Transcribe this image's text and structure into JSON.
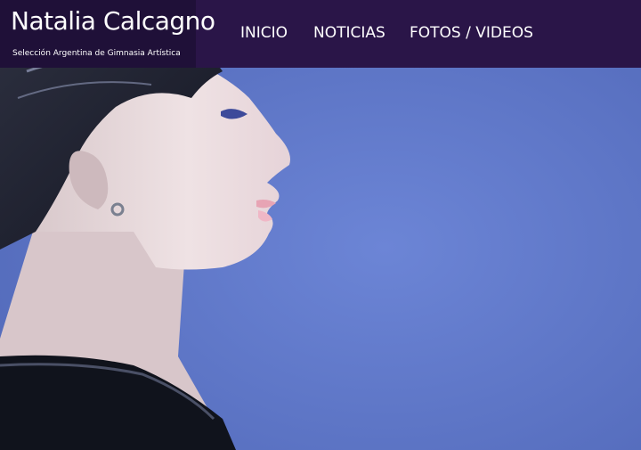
{
  "brand": {
    "title": "Natalia Calcagno",
    "subtitle": "Selección Argentina de Gimnasia Artística"
  },
  "nav": {
    "items": [
      {
        "label": "INICIO"
      },
      {
        "label": "NOTICIAS"
      },
      {
        "label": "FOTOS / VIDEOS"
      }
    ]
  },
  "colors": {
    "header_bg": "#2a1548",
    "brand_bg": "#1c0f33",
    "hero_sky": "#5a73c4",
    "text": "#ffffff"
  }
}
